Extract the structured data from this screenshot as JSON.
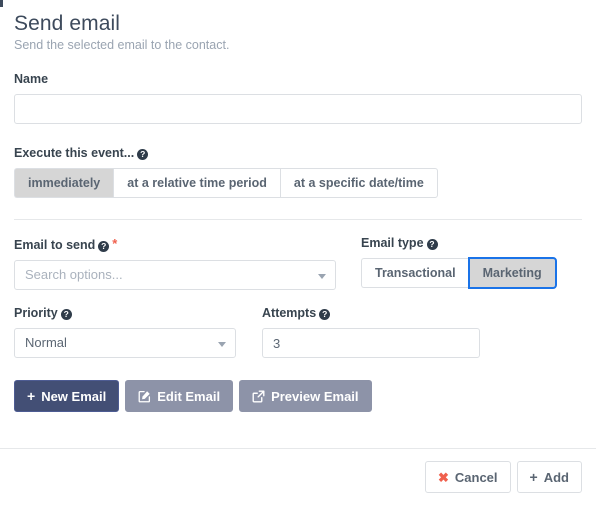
{
  "header": {
    "title": "Send email",
    "subtitle": "Send the selected email to the contact."
  },
  "name_field": {
    "label": "Name",
    "value": "",
    "placeholder": ""
  },
  "execute_event": {
    "label": "Execute this event...",
    "help_icon": "question-circle-icon",
    "options": [
      {
        "label": "immediately",
        "active": true
      },
      {
        "label": "at a relative time period",
        "active": false
      },
      {
        "label": "at a specific date/time",
        "active": false
      }
    ]
  },
  "email_to_send": {
    "label": "Email to send",
    "help_icon": "question-circle-icon",
    "required_marker": "*",
    "placeholder": "Search options...",
    "value": "",
    "caret_icon": "chevron-down-icon"
  },
  "email_type": {
    "label": "Email type",
    "help_icon": "question-circle-icon",
    "options": [
      {
        "label": "Transactional",
        "active": false,
        "focused": false
      },
      {
        "label": "Marketing",
        "active": true,
        "focused": true
      }
    ]
  },
  "priority": {
    "label": "Priority",
    "help_icon": "question-circle-icon",
    "value": "Normal",
    "caret_icon": "chevron-down-icon"
  },
  "attempts": {
    "label": "Attempts",
    "help_icon": "question-circle-icon",
    "value": "3"
  },
  "actions": [
    {
      "label": "New Email",
      "icon": "plus-icon",
      "style": "primary"
    },
    {
      "label": "Edit Email",
      "icon": "pencil-square-icon",
      "style": "muted"
    },
    {
      "label": "Preview Email",
      "icon": "external-link-icon",
      "style": "muted"
    }
  ],
  "footer": {
    "cancel_label": "Cancel",
    "cancel_icon": "times-icon",
    "add_label": "Add",
    "add_icon": "plus-icon"
  },
  "colors": {
    "primary_button": "#434f75",
    "muted_button": "#8d93a8",
    "focus_ring": "#1a73e8",
    "required_star": "#f0604d",
    "cancel_icon": "#f0604d",
    "title_text": "#3d4a5c",
    "subtitle_text": "#9aa4b1",
    "border": "#dcdfe3",
    "active_segment": "#d6d6d6"
  },
  "help_glyph": "?"
}
